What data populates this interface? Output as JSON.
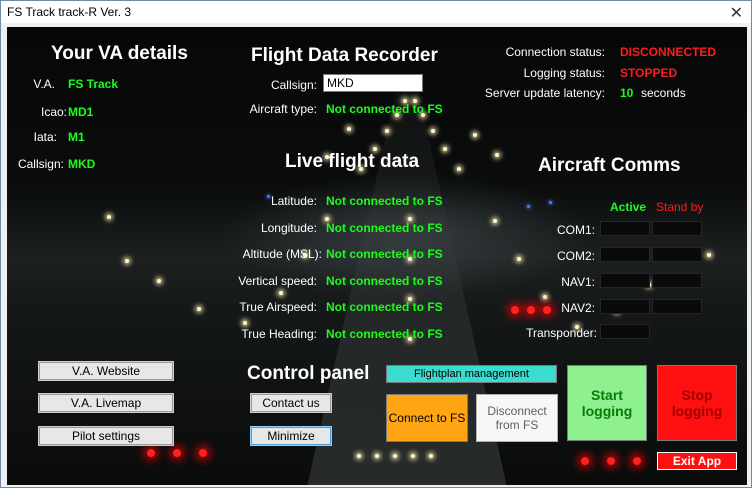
{
  "window": {
    "title": "FS Track track-R Ver. 3",
    "close": "✕"
  },
  "va": {
    "heading": "Your VA details",
    "rows": [
      {
        "label": "V.A.",
        "value": "FS Track"
      },
      {
        "label": "Icao:",
        "value": "MD1"
      },
      {
        "label": "Iata:",
        "value": "M1"
      },
      {
        "label": "Callsign:",
        "value": "MKD"
      }
    ]
  },
  "fdr": {
    "heading": "Flight Data Recorder",
    "callsign_label": "Callsign:",
    "callsign_value": "MKD",
    "aircraft_label": "Aircraft type:",
    "aircraft_value": "Not connected to FS"
  },
  "status": {
    "connection_label": "Connection status:",
    "connection_value": "DISCONNECTED",
    "logging_label": "Logging status:",
    "logging_value": "STOPPED",
    "latency_label": "Server update latency:",
    "latency_value": "10",
    "latency_unit": "seconds"
  },
  "live": {
    "heading": "Live flight data",
    "rows": [
      {
        "label": "Latitude:",
        "value": "Not connected to FS"
      },
      {
        "label": "Longitude:",
        "value": "Not connected to FS"
      },
      {
        "label": "Altitude (MSL):",
        "value": "Not connected to FS"
      },
      {
        "label": "Vertical speed:",
        "value": "Not connected to FS"
      },
      {
        "label": "True Airspeed:",
        "value": "Not connected to FS"
      },
      {
        "label": "True Heading:",
        "value": "Not connected to FS"
      }
    ]
  },
  "comms": {
    "heading": "Aircraft Comms",
    "active_label": "Active",
    "standby_label": "Stand by",
    "rows": [
      "COM1:",
      "COM2:",
      "NAV1:",
      "NAV2:",
      "Transponder:"
    ]
  },
  "control": {
    "heading": "Control panel",
    "va_website": "V.A. Website",
    "va_livemap": "V.A. Livemap",
    "pilot_settings": "Pilot settings",
    "contact_us": "Contact us",
    "minimize": "Minimize",
    "flightplan": "Flightplan management",
    "connect": "Connect to FS",
    "disconnect": "Disconnect from FS",
    "start_logging": "Start logging",
    "stop_logging": "Stop logging",
    "exit": "Exit App"
  },
  "colors": {
    "value_green": "#19ff19",
    "status_red": "#ff1c1c",
    "start_green": "#8ef08e",
    "stop_red": "#ff1010",
    "connect_orange": "#ffa514",
    "flightplan_teal": "#39dccf"
  }
}
